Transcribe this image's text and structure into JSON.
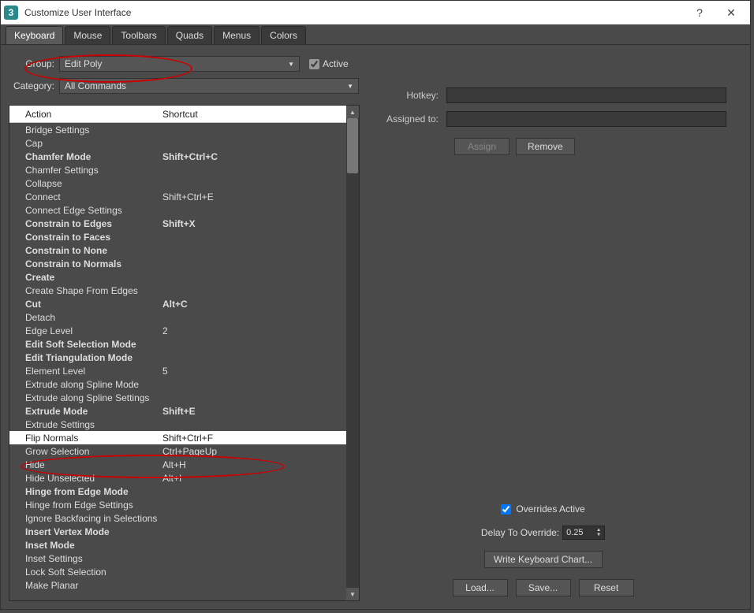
{
  "window": {
    "title": "Customize User Interface",
    "icon_char": "3"
  },
  "tabs": [
    {
      "label": "Keyboard",
      "active": true
    },
    {
      "label": "Mouse",
      "active": false
    },
    {
      "label": "Toolbars",
      "active": false
    },
    {
      "label": "Quads",
      "active": false
    },
    {
      "label": "Menus",
      "active": false
    },
    {
      "label": "Colors",
      "active": false
    }
  ],
  "group_label": "Group:",
  "group_value": "Edit Poly",
  "active_label": "Active",
  "category_label": "Category:",
  "category_value": "All Commands",
  "table": {
    "col_action": "Action",
    "col_shortcut": "Shortcut",
    "rows": [
      {
        "action": "Bridge Settings",
        "shortcut": "",
        "bold": false,
        "selected": false
      },
      {
        "action": "Cap",
        "shortcut": "",
        "bold": false,
        "selected": false
      },
      {
        "action": "Chamfer Mode",
        "shortcut": "Shift+Ctrl+C",
        "bold": true,
        "selected": false
      },
      {
        "action": "Chamfer Settings",
        "shortcut": "",
        "bold": false,
        "selected": false
      },
      {
        "action": "Collapse",
        "shortcut": "",
        "bold": false,
        "selected": false
      },
      {
        "action": "Connect",
        "shortcut": "Shift+Ctrl+E",
        "bold": false,
        "selected": false
      },
      {
        "action": "Connect Edge Settings",
        "shortcut": "",
        "bold": false,
        "selected": false
      },
      {
        "action": "Constrain to Edges",
        "shortcut": "Shift+X",
        "bold": true,
        "selected": false
      },
      {
        "action": "Constrain to Faces",
        "shortcut": "",
        "bold": true,
        "selected": false
      },
      {
        "action": "Constrain to None",
        "shortcut": "",
        "bold": true,
        "selected": false
      },
      {
        "action": "Constrain to Normals",
        "shortcut": "",
        "bold": true,
        "selected": false
      },
      {
        "action": "Create",
        "shortcut": "",
        "bold": true,
        "selected": false
      },
      {
        "action": "Create Shape From Edges",
        "shortcut": "",
        "bold": false,
        "selected": false
      },
      {
        "action": "Cut",
        "shortcut": "Alt+C",
        "bold": true,
        "selected": false
      },
      {
        "action": "Detach",
        "shortcut": "",
        "bold": false,
        "selected": false
      },
      {
        "action": "Edge Level",
        "shortcut": "2",
        "bold": false,
        "selected": false
      },
      {
        "action": "Edit Soft Selection Mode",
        "shortcut": "",
        "bold": true,
        "selected": false
      },
      {
        "action": "Edit Triangulation Mode",
        "shortcut": "",
        "bold": true,
        "selected": false
      },
      {
        "action": "Element Level",
        "shortcut": "5",
        "bold": false,
        "selected": false
      },
      {
        "action": "Extrude along Spline Mode",
        "shortcut": "",
        "bold": false,
        "selected": false
      },
      {
        "action": "Extrude along Spline Settings",
        "shortcut": "",
        "bold": false,
        "selected": false
      },
      {
        "action": "Extrude Mode",
        "shortcut": "Shift+E",
        "bold": true,
        "selected": false
      },
      {
        "action": "Extrude Settings",
        "shortcut": "",
        "bold": false,
        "selected": false
      },
      {
        "action": "Flip Normals",
        "shortcut": "Shift+Ctrl+F",
        "bold": false,
        "selected": true
      },
      {
        "action": "Grow Selection",
        "shortcut": "Ctrl+PageUp",
        "bold": false,
        "selected": false
      },
      {
        "action": "Hide",
        "shortcut": "Alt+H",
        "bold": false,
        "selected": false
      },
      {
        "action": "Hide Unselected",
        "shortcut": "Alt+I",
        "bold": false,
        "selected": false
      },
      {
        "action": "Hinge from Edge Mode",
        "shortcut": "",
        "bold": true,
        "selected": false
      },
      {
        "action": "Hinge from Edge Settings",
        "shortcut": "",
        "bold": false,
        "selected": false
      },
      {
        "action": "Ignore Backfacing in Selections",
        "shortcut": "",
        "bold": false,
        "selected": false
      },
      {
        "action": "Insert Vertex Mode",
        "shortcut": "",
        "bold": true,
        "selected": false
      },
      {
        "action": "Inset Mode",
        "shortcut": "",
        "bold": true,
        "selected": false
      },
      {
        "action": "Inset Settings",
        "shortcut": "",
        "bold": false,
        "selected": false
      },
      {
        "action": "Lock Soft Selection",
        "shortcut": "",
        "bold": false,
        "selected": false
      },
      {
        "action": "Make Planar",
        "shortcut": "",
        "bold": false,
        "selected": false
      }
    ]
  },
  "hotkey_label": "Hotkey:",
  "assigned_label": "Assigned to:",
  "assign_btn": "Assign",
  "remove_btn": "Remove",
  "overrides_label": "Overrides Active",
  "delay_label": "Delay To Override:",
  "delay_value": "0.25",
  "write_chart_btn": "Write Keyboard Chart...",
  "load_btn": "Load...",
  "save_btn": "Save...",
  "reset_btn": "Reset"
}
